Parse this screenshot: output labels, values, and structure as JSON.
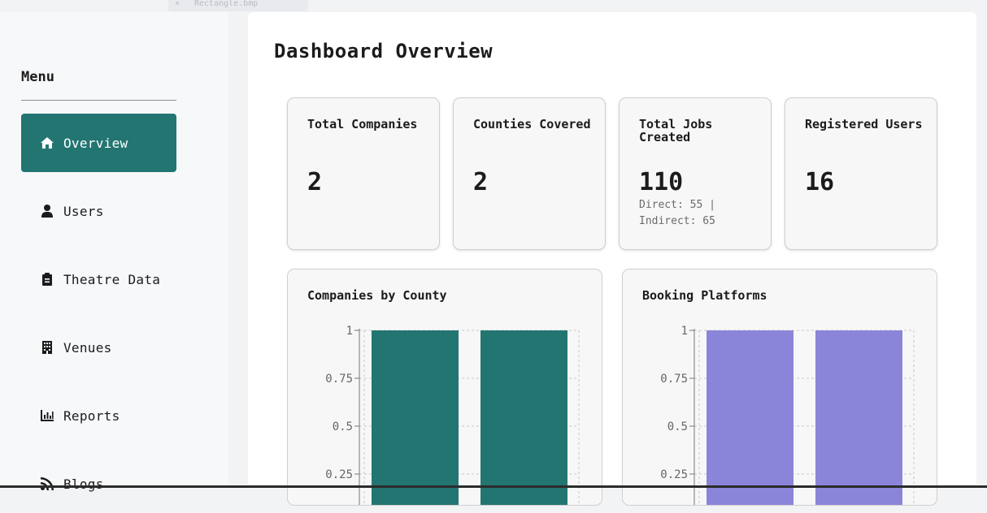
{
  "browser_tab": {
    "close": "×",
    "title": "Rectangle.bmp"
  },
  "sidebar": {
    "title": "Menu",
    "items": [
      {
        "label": "Overview",
        "icon": "home-icon",
        "active": true
      },
      {
        "label": "Users",
        "icon": "user-icon",
        "active": false
      },
      {
        "label": "Theatre Data",
        "icon": "clipboard-icon",
        "active": false
      },
      {
        "label": "Venues",
        "icon": "building-icon",
        "active": false
      },
      {
        "label": "Reports",
        "icon": "bar-chart-icon",
        "active": false
      },
      {
        "label": "Blogs",
        "icon": "rss-icon",
        "active": false
      }
    ]
  },
  "main": {
    "title": "Dashboard Overview",
    "stats": [
      {
        "label": "Total Companies",
        "value": "2",
        "sub": ""
      },
      {
        "label": "Counties Covered",
        "value": "2",
        "sub": ""
      },
      {
        "label": "Total Jobs Created",
        "value": "110",
        "sub": "Direct: 55 | Indirect: 65"
      },
      {
        "label": "Registered Users",
        "value": "16",
        "sub": ""
      }
    ]
  },
  "colors": {
    "accent": "#237572",
    "platform_bar": "#8a85d9"
  },
  "chart_data": [
    {
      "type": "bar",
      "title": "Companies by County",
      "categories": [
        "",
        ""
      ],
      "values": [
        1,
        1
      ],
      "yticks": [
        "1",
        "0.75",
        "0.5",
        "0.25"
      ],
      "ylim": [
        0,
        1
      ],
      "grid": true,
      "color": "#237572"
    },
    {
      "type": "bar",
      "title": "Booking Platforms",
      "categories": [
        "",
        ""
      ],
      "values": [
        1,
        1
      ],
      "yticks": [
        "1",
        "0.75",
        "0.5",
        "0.25"
      ],
      "ylim": [
        0,
        1
      ],
      "grid": true,
      "color": "#8a85d9"
    }
  ]
}
